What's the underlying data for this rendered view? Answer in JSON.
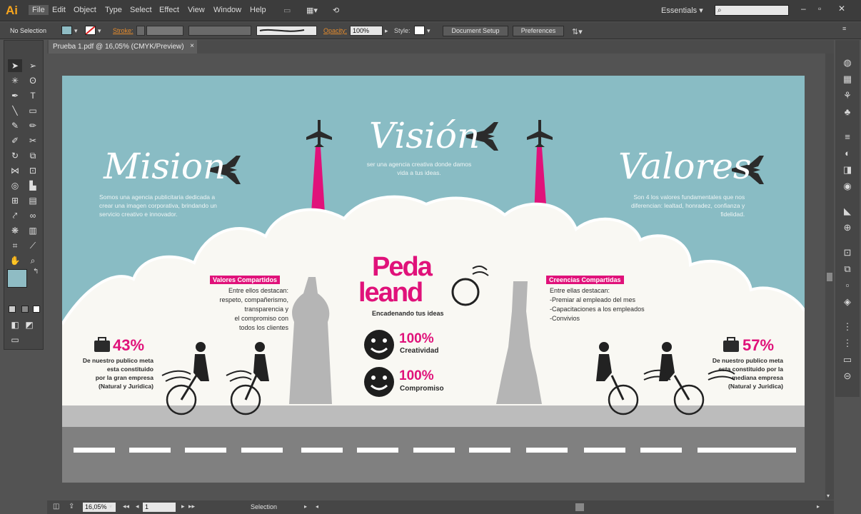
{
  "app": {
    "logo": "Ai",
    "workspace": "Essentials"
  },
  "menu": [
    "File",
    "Edit",
    "Object",
    "Type",
    "Select",
    "Effect",
    "View",
    "Window",
    "Help"
  ],
  "control_bar": {
    "selection_label": "No Selection",
    "stroke_label": "Stroke:",
    "opacity_label": "Opacity:",
    "opacity_value": "100%",
    "style_label": "Style:",
    "document_setup": "Document Setup",
    "preferences": "Preferences"
  },
  "document_tab": {
    "title": "Prueba 1.pdf @ 16,05% (CMYK/Preview)",
    "close": "×"
  },
  "status": {
    "zoom": "16,05%",
    "artboard": "1",
    "tool": "Selection"
  },
  "artwork": {
    "mision": {
      "title": "Mision",
      "text": [
        "Somos una agencia publicitaria dedicada a",
        "crear una imagen corporativa, brindando un",
        "servicio creativo e innovador."
      ]
    },
    "vision": {
      "title": "Visión",
      "text": [
        "ser una agencia creativa donde damos",
        "vida a tus ideas."
      ]
    },
    "valores": {
      "title": "Valores",
      "text": [
        "Son 4 los valores fundamentales que nos",
        "diferencian: lealtad, honradez, confianza y",
        "fidelidad."
      ]
    },
    "logo": {
      "line1": "Peda",
      "line2": "leand",
      "tagline": "Encadenando tus ideas"
    },
    "valores_compartidos": {
      "label": "Valores Compartidos",
      "text": [
        "Entre ellos destacan:",
        "respeto, compañerismo,",
        "transparencia y",
        "el compromiso con",
        "todos los clientes"
      ]
    },
    "creencias_compartidas": {
      "label": "Creencias Compartidas",
      "text": [
        "Entre ellas destacan:",
        "-Premiar al empleado del mes",
        "-Capacitaciones a los empleados",
        "-Convivios"
      ]
    },
    "stat_left": {
      "value": "43%",
      "text": [
        "De nuestro publico meta",
        "esta constituido",
        "por la gran empresa",
        "(Natural y Juridica)"
      ]
    },
    "stat_right": {
      "value": "57%",
      "text": [
        "De nuestro publico meta",
        "esta constituido por la",
        "mediana empresa",
        "(Natural y Juridica)"
      ]
    },
    "creatividad": {
      "value": "100%",
      "label": "Creatividad"
    },
    "compromiso": {
      "value": "100%",
      "label": "Compromiso"
    }
  },
  "colors": {
    "accent": "#e0127a",
    "sky": "#89bcc4",
    "cloud": "#f9f8f3",
    "road": "#808080",
    "ground": "#bcbcbc"
  }
}
